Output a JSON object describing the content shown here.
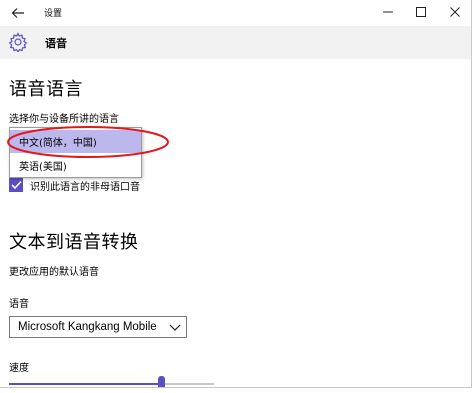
{
  "window": {
    "title": "设置",
    "controls": {
      "minimize": "—",
      "maximize": "☐",
      "close": "✕"
    }
  },
  "header": {
    "title": "语音",
    "icon": "gear-icon"
  },
  "speech_language": {
    "heading": "语音语言",
    "prompt": "选择你与设备所讲的语言",
    "options": [
      "中文(简体，中国)",
      "英语(美国)"
    ],
    "selected_index": 0,
    "checkbox_label": "识别此语言的非母语口音",
    "checkbox_checked": true
  },
  "tts": {
    "heading": "文本到语音转换",
    "subtitle": "更改应用的默认语音",
    "voice_label": "语音",
    "voice_value": "Microsoft Kangkang Mobile",
    "speed_label": "速度",
    "speed_fraction": 0.74
  },
  "colors": {
    "accent": "#5a4fc2",
    "selection": "#bcb7ec",
    "annotation": "#e0191e",
    "header_bg": "#f2f2f2"
  }
}
